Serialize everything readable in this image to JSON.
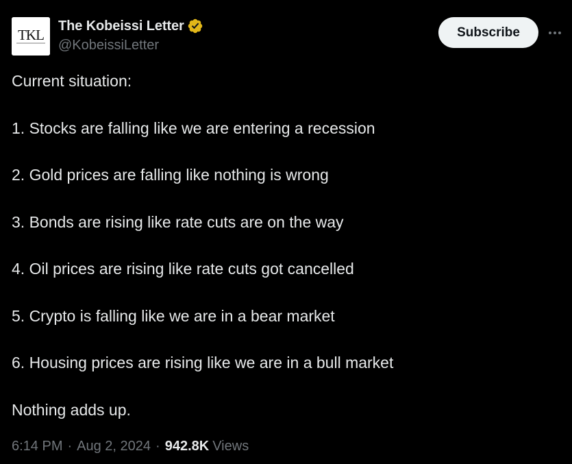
{
  "author": {
    "avatar_text": "TKL",
    "display_name": "The Kobeissi Letter",
    "handle": "@KobeissiLetter",
    "verified_icon": "verified-badge-icon",
    "verified_color": "#e2b719"
  },
  "actions": {
    "subscribe_label": "Subscribe",
    "more_icon": "more-options-icon"
  },
  "post": {
    "lines": [
      "Current situation:",
      "1. Stocks are falling like we are entering a recession",
      "2. Gold prices are falling like nothing is wrong",
      "3. Bonds are rising like rate cuts are on the way",
      "4. Oil prices are rising like rate cuts got cancelled",
      "5. Crypto is falling like we are in a bear market",
      "6. Housing prices are rising like we are in a bull market",
      "Nothing adds up."
    ]
  },
  "meta": {
    "time": "6:14 PM",
    "separator": "·",
    "date": "Aug 2, 2024",
    "views_count": "942.8K",
    "views_label": "Views"
  },
  "colors": {
    "background": "#000000",
    "text_primary": "#e7e9ea",
    "text_secondary": "#71767b",
    "button_bg": "#eff3f4"
  }
}
